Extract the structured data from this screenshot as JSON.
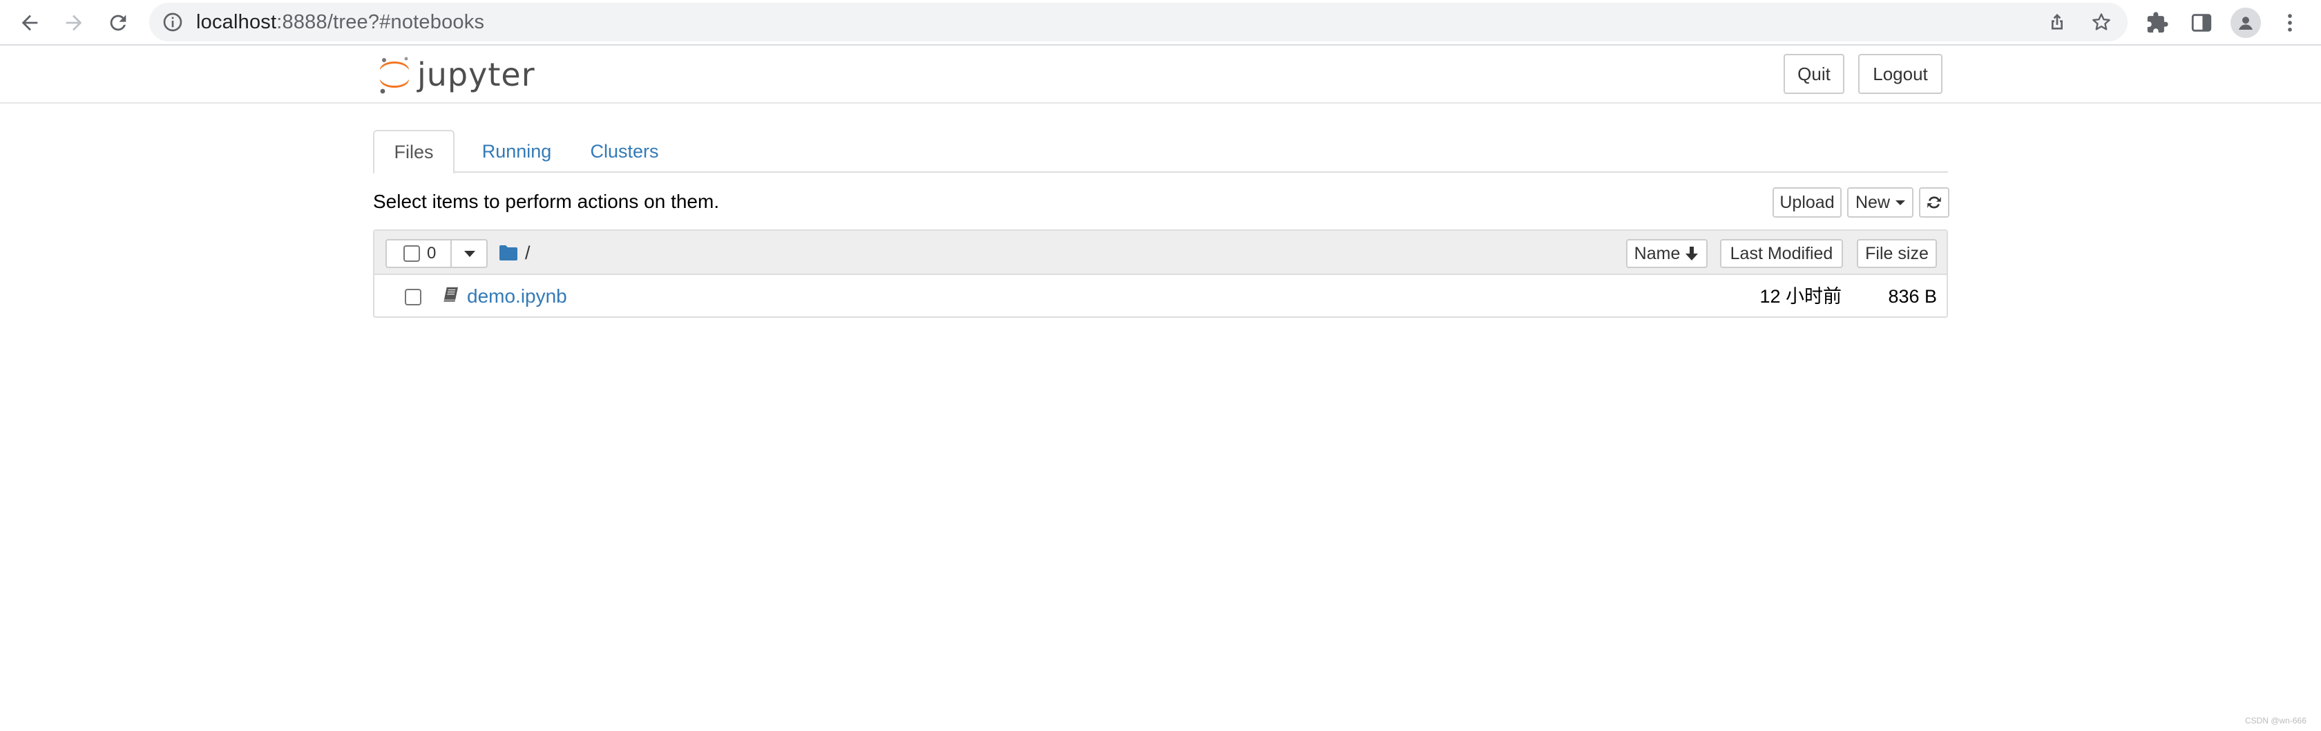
{
  "browser": {
    "url_host": "localhost",
    "url_path": ":8888/tree?#notebooks",
    "icons": {
      "back": "arrow-left-icon",
      "forward": "arrow-right-icon",
      "reload": "reload-icon",
      "site_info": "info-icon",
      "share": "share-icon",
      "bookmark": "star-icon",
      "extensions": "puzzle-icon",
      "side_panel": "side-panel-icon",
      "profile": "profile-icon",
      "menu": "kebab-menu-icon"
    }
  },
  "header": {
    "logo_text": "jupyter",
    "quit_label": "Quit",
    "logout_label": "Logout"
  },
  "tabs": [
    {
      "label": "Files",
      "active": true
    },
    {
      "label": "Running",
      "active": false
    },
    {
      "label": "Clusters",
      "active": false
    }
  ],
  "toolbar": {
    "hint": "Select items to perform actions on them.",
    "upload_label": "Upload",
    "new_label": "New",
    "refresh_icon": "refresh-icon"
  },
  "list_header": {
    "selected_count": "0",
    "breadcrumb": "/",
    "name_label": "Name",
    "last_modified_label": "Last Modified",
    "file_size_label": "File size"
  },
  "files": [
    {
      "name": "demo.ipynb",
      "modified": "12 小时前",
      "size": "836 B",
      "icon": "notebook-icon"
    }
  ],
  "watermark": "CSDN @wn-666",
  "colors": {
    "link": "#337ab7",
    "jupyter_orange": "#f37726",
    "header_bg": "#eeeeee",
    "border": "#dddddd"
  }
}
